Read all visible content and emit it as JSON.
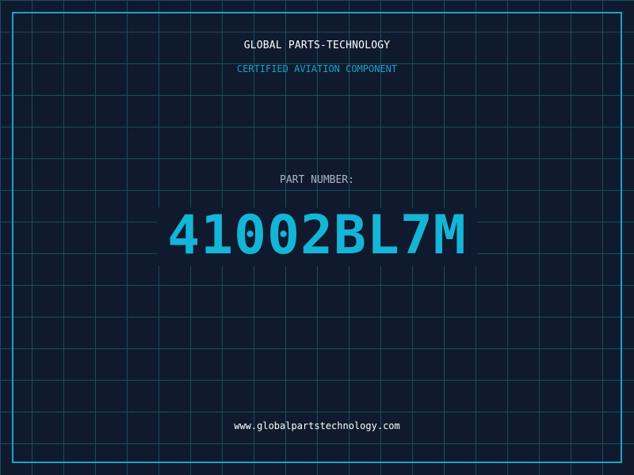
{
  "header": {
    "company_name": "GLOBAL PARTS-TECHNOLOGY",
    "subtitle": "CERTIFIED AVIATION COMPONENT"
  },
  "part": {
    "label": "PART NUMBER:",
    "number": "41002BL7M"
  },
  "footer": {
    "website": "www.globalpartstechnology.com"
  },
  "colors": {
    "background": "#0f1a2e",
    "grid": "#1f4a63",
    "accent": "#1aa4c8",
    "part_number": "#14b5d6",
    "label": "#a9b7c6",
    "text": "#ffffff"
  }
}
